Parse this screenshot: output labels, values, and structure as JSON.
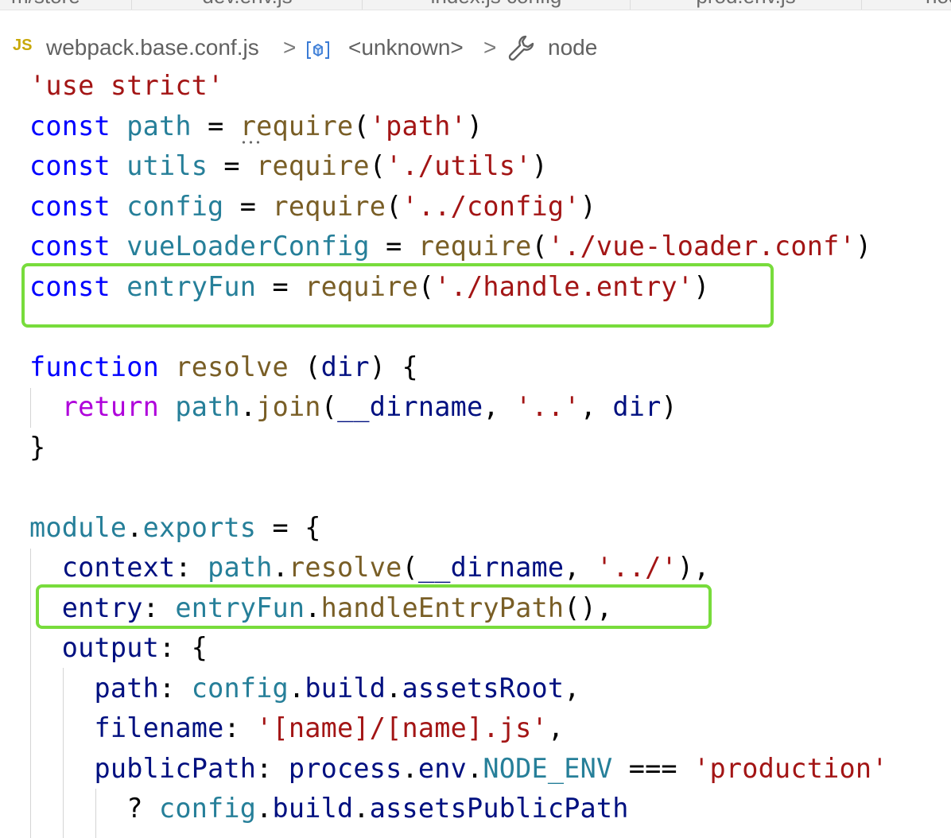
{
  "editor_tabs": [
    {
      "label": "m/store"
    },
    {
      "label": "dev.env.js"
    },
    {
      "label": "index.js  config"
    },
    {
      "label": "prod.env.js"
    },
    {
      "label": "node"
    }
  ],
  "breadcrumb": {
    "file_icon": "JS",
    "file": "webpack.base.conf.js",
    "separator": ">",
    "symbol_icon": "variable-symbol-icon",
    "symbol": "<unknown>",
    "property_icon": "wrench-icon",
    "property": "node"
  },
  "code": {
    "lines": [
      [
        {
          "t": "'use strict'",
          "c": "str"
        }
      ],
      [
        {
          "t": "const",
          "c": "kw"
        },
        {
          "t": " ",
          "c": "plain"
        },
        {
          "t": "path",
          "c": "var"
        },
        {
          "t": " = ",
          "c": "plain"
        },
        {
          "t": "require",
          "c": "fn"
        },
        {
          "t": "(",
          "c": "plain"
        },
        {
          "t": "'path'",
          "c": "str"
        },
        {
          "t": ")",
          "c": "plain"
        }
      ],
      [
        {
          "t": "const",
          "c": "kw"
        },
        {
          "t": " ",
          "c": "plain"
        },
        {
          "t": "utils",
          "c": "var"
        },
        {
          "t": " = ",
          "c": "plain"
        },
        {
          "t": "require",
          "c": "fn"
        },
        {
          "t": "(",
          "c": "plain"
        },
        {
          "t": "'./utils'",
          "c": "str"
        },
        {
          "t": ")",
          "c": "plain"
        }
      ],
      [
        {
          "t": "const",
          "c": "kw"
        },
        {
          "t": " ",
          "c": "plain"
        },
        {
          "t": "config",
          "c": "var"
        },
        {
          "t": " = ",
          "c": "plain"
        },
        {
          "t": "require",
          "c": "fn"
        },
        {
          "t": "(",
          "c": "plain"
        },
        {
          "t": "'../config'",
          "c": "str"
        },
        {
          "t": ")",
          "c": "plain"
        }
      ],
      [
        {
          "t": "const",
          "c": "kw"
        },
        {
          "t": " ",
          "c": "plain"
        },
        {
          "t": "vueLoaderConfig",
          "c": "var"
        },
        {
          "t": " = ",
          "c": "plain"
        },
        {
          "t": "require",
          "c": "fn"
        },
        {
          "t": "(",
          "c": "plain"
        },
        {
          "t": "'./vue-loader.conf'",
          "c": "str"
        },
        {
          "t": ")",
          "c": "plain"
        }
      ],
      [
        {
          "t": "const",
          "c": "kw"
        },
        {
          "t": " ",
          "c": "plain"
        },
        {
          "t": "entryFun",
          "c": "var"
        },
        {
          "t": " = ",
          "c": "plain"
        },
        {
          "t": "require",
          "c": "fn"
        },
        {
          "t": "(",
          "c": "plain"
        },
        {
          "t": "'./handle.entry'",
          "c": "str"
        },
        {
          "t": ")",
          "c": "plain"
        }
      ],
      [],
      [
        {
          "t": "function",
          "c": "kw"
        },
        {
          "t": " ",
          "c": "plain"
        },
        {
          "t": "resolve",
          "c": "fn"
        },
        {
          "t": " (",
          "c": "plain"
        },
        {
          "t": "dir",
          "c": "prop"
        },
        {
          "t": ") {",
          "c": "plain"
        }
      ],
      [
        {
          "t": "  ",
          "c": "plain"
        },
        {
          "t": "return",
          "c": "ctrl"
        },
        {
          "t": " ",
          "c": "plain"
        },
        {
          "t": "path",
          "c": "var"
        },
        {
          "t": ".",
          "c": "plain"
        },
        {
          "t": "join",
          "c": "fn"
        },
        {
          "t": "(",
          "c": "plain"
        },
        {
          "t": "__dirname",
          "c": "prop"
        },
        {
          "t": ", ",
          "c": "plain"
        },
        {
          "t": "'..'",
          "c": "str"
        },
        {
          "t": ", ",
          "c": "plain"
        },
        {
          "t": "dir",
          "c": "prop"
        },
        {
          "t": ")",
          "c": "plain"
        }
      ],
      [
        {
          "t": "}",
          "c": "plain"
        }
      ],
      [],
      [
        {
          "t": "module",
          "c": "var"
        },
        {
          "t": ".",
          "c": "plain"
        },
        {
          "t": "exports",
          "c": "var"
        },
        {
          "t": " = {",
          "c": "plain"
        }
      ],
      [
        {
          "t": "  ",
          "c": "plain"
        },
        {
          "t": "context",
          "c": "prop"
        },
        {
          "t": ": ",
          "c": "plain"
        },
        {
          "t": "path",
          "c": "var"
        },
        {
          "t": ".",
          "c": "plain"
        },
        {
          "t": "resolve",
          "c": "fn"
        },
        {
          "t": "(",
          "c": "plain"
        },
        {
          "t": "__dirname",
          "c": "prop"
        },
        {
          "t": ", ",
          "c": "plain"
        },
        {
          "t": "'../'",
          "c": "str"
        },
        {
          "t": "),",
          "c": "plain"
        }
      ],
      [
        {
          "t": "  ",
          "c": "plain"
        },
        {
          "t": "entry",
          "c": "prop"
        },
        {
          "t": ": ",
          "c": "plain"
        },
        {
          "t": "entryFun",
          "c": "var"
        },
        {
          "t": ".",
          "c": "plain"
        },
        {
          "t": "handleEntryPath",
          "c": "fn"
        },
        {
          "t": "(),",
          "c": "plain"
        }
      ],
      [
        {
          "t": "  ",
          "c": "plain"
        },
        {
          "t": "output",
          "c": "prop"
        },
        {
          "t": ": {",
          "c": "plain"
        }
      ],
      [
        {
          "t": "    ",
          "c": "plain"
        },
        {
          "t": "path",
          "c": "prop"
        },
        {
          "t": ": ",
          "c": "plain"
        },
        {
          "t": "config",
          "c": "var"
        },
        {
          "t": ".",
          "c": "plain"
        },
        {
          "t": "build",
          "c": "prop"
        },
        {
          "t": ".",
          "c": "plain"
        },
        {
          "t": "assetsRoot",
          "c": "prop"
        },
        {
          "t": ",",
          "c": "plain"
        }
      ],
      [
        {
          "t": "    ",
          "c": "plain"
        },
        {
          "t": "filename",
          "c": "prop"
        },
        {
          "t": ": ",
          "c": "plain"
        },
        {
          "t": "'[name]/[name].js'",
          "c": "str"
        },
        {
          "t": ",",
          "c": "plain"
        }
      ],
      [
        {
          "t": "    ",
          "c": "plain"
        },
        {
          "t": "publicPath",
          "c": "prop"
        },
        {
          "t": ": ",
          "c": "plain"
        },
        {
          "t": "process",
          "c": "prop"
        },
        {
          "t": ".",
          "c": "plain"
        },
        {
          "t": "env",
          "c": "prop"
        },
        {
          "t": ".",
          "c": "plain"
        },
        {
          "t": "NODE_ENV",
          "c": "var"
        },
        {
          "t": " === ",
          "c": "plain"
        },
        {
          "t": "'production'",
          "c": "str"
        }
      ],
      [
        {
          "t": "      ? ",
          "c": "plain"
        },
        {
          "t": "config",
          "c": "var"
        },
        {
          "t": ".",
          "c": "plain"
        },
        {
          "t": "build",
          "c": "prop"
        },
        {
          "t": ".",
          "c": "plain"
        },
        {
          "t": "assetsPublicPath",
          "c": "prop"
        }
      ]
    ]
  },
  "highlight_color": "#78dc3c"
}
